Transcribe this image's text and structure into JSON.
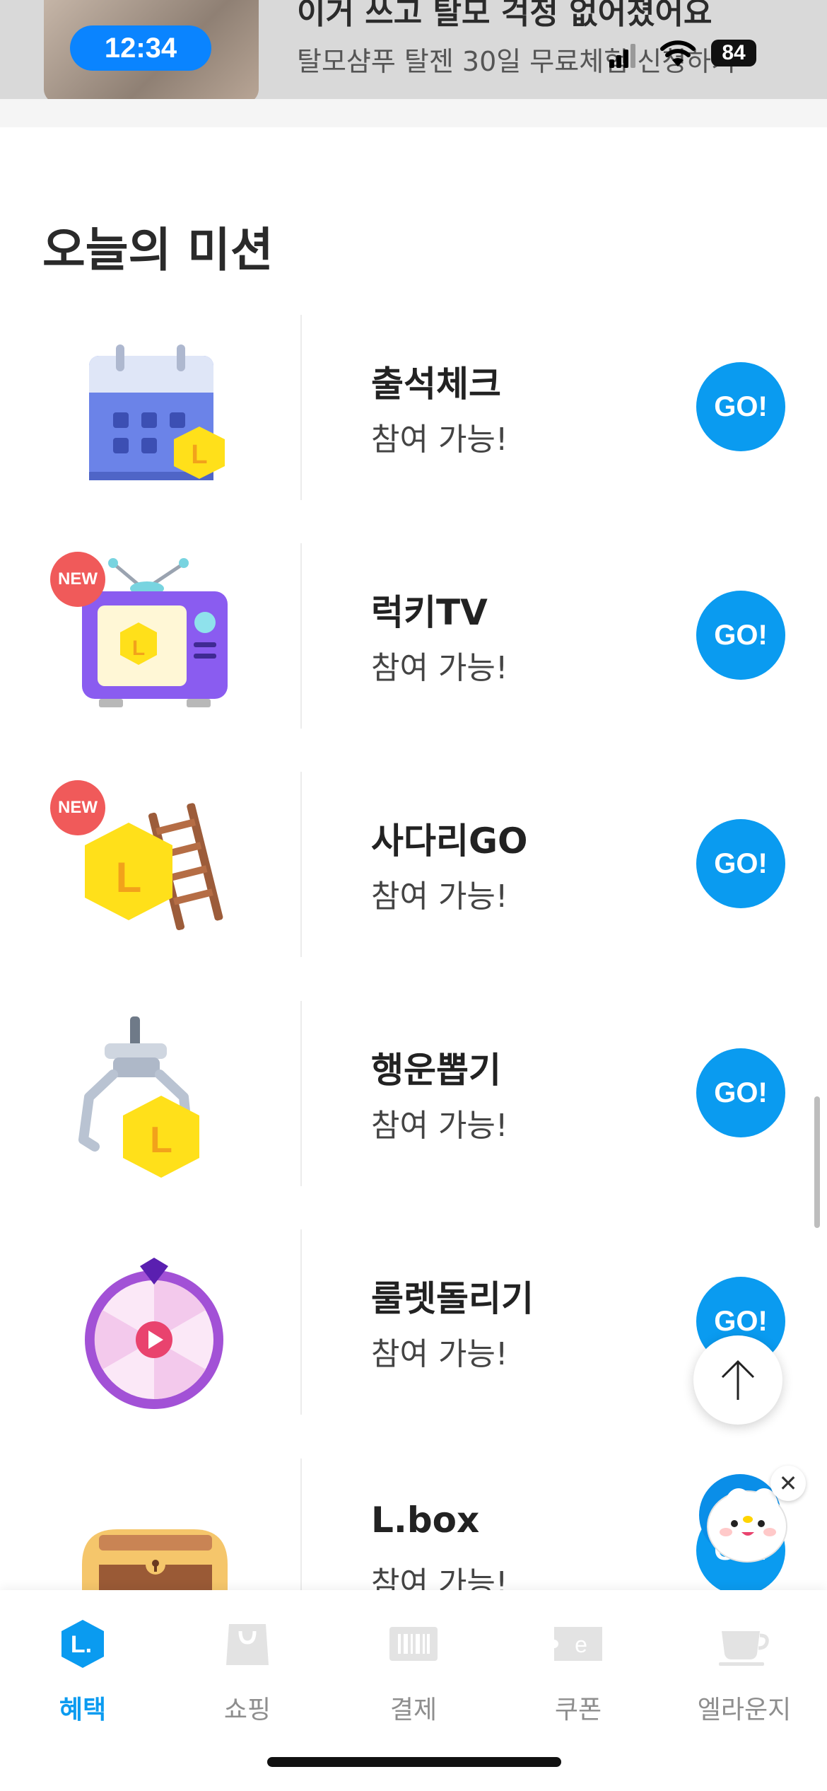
{
  "status_bar": {
    "time": "12:34",
    "battery": "84"
  },
  "ad_banner": {
    "title": "이거 쓰고 탈모 걱정 없어졌어요",
    "subtitle": "탈모샴푸 탈젠 30일 무료체험 신청하기"
  },
  "section": {
    "title": "오늘의 미션"
  },
  "missions": [
    {
      "name": "출석체크",
      "status": "참여 가능!",
      "button": "GO!",
      "badge": "",
      "icon": "calendar-coin-icon"
    },
    {
      "name": "럭키TV",
      "status": "참여 가능!",
      "button": "GO!",
      "badge": "NEW",
      "icon": "tv-coin-icon"
    },
    {
      "name": "사다리GO",
      "status": "참여 가능!",
      "button": "GO!",
      "badge": "NEW",
      "icon": "ladder-coin-icon"
    },
    {
      "name": "행운뽑기",
      "status": "참여 가능!",
      "button": "GO!",
      "badge": "",
      "icon": "claw-coin-icon"
    },
    {
      "name": "룰렛돌리기",
      "status": "참여 가능!",
      "button": "GO!",
      "badge": "",
      "icon": "roulette-icon"
    },
    {
      "name": "L.box",
      "status": "참여 가능!",
      "button": "GO!",
      "badge": "",
      "icon": "treasure-chest-icon"
    }
  ],
  "floating": {
    "close_symbol": "✕"
  },
  "bottom_nav": {
    "items": [
      {
        "label": "혜택",
        "icon": "l-point-icon",
        "active": true
      },
      {
        "label": "쇼핑",
        "icon": "shopping-bag-icon",
        "active": false
      },
      {
        "label": "결제",
        "icon": "barcode-icon",
        "active": false
      },
      {
        "label": "쿠폰",
        "icon": "coupon-icon",
        "active": false
      },
      {
        "label": "엘라운지",
        "icon": "coffee-cup-icon",
        "active": false
      }
    ]
  },
  "colors": {
    "accent": "#0a9bf0",
    "new_badge": "#f05a5a",
    "coin": "#ffe01a",
    "time_pill": "#0a84ff"
  }
}
